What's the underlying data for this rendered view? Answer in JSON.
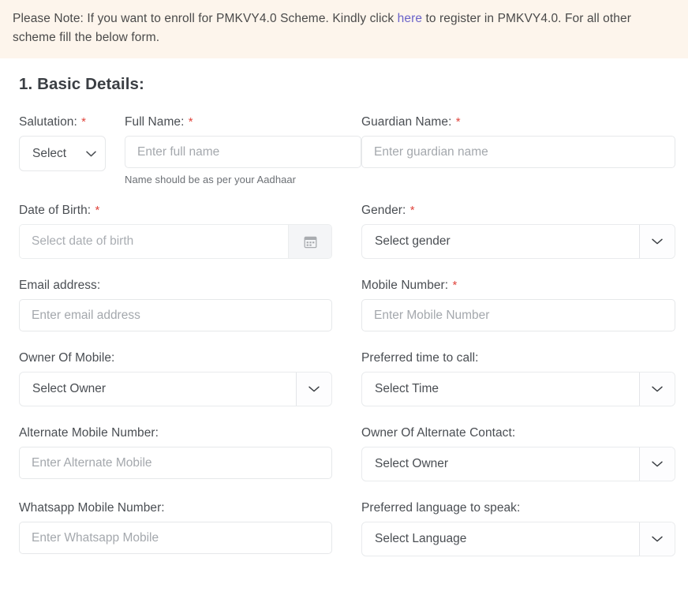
{
  "notice": {
    "text_before_link": "Please Note: If you want to enroll for PMKVY4.0 Scheme. Kindly click ",
    "link_label": "here",
    "text_after_link": " to register in PMKVY4.0. For all other scheme fill the below form.",
    "background_color": "#fdf5ec",
    "link_color": "#6a63c9"
  },
  "section": {
    "title": "1. Basic Details:",
    "required_marker": "*",
    "required_color": "#e0453d"
  },
  "fields": {
    "salutation": {
      "label": "Salutation:",
      "required": true,
      "selected": "Select",
      "icon": "chevron-down-icon"
    },
    "full_name": {
      "label": "Full Name:",
      "required": true,
      "value": "",
      "placeholder": "Enter full name",
      "helper": "Name should be as per your Aadhaar"
    },
    "guardian_name": {
      "label": "Guardian Name:",
      "required": true,
      "value": "",
      "placeholder": "Enter guardian name"
    },
    "date_of_birth": {
      "label": "Date of Birth:",
      "required": true,
      "value": "",
      "placeholder": "Select date of birth",
      "icon": "calendar-icon"
    },
    "gender": {
      "label": "Gender:",
      "required": true,
      "selected": "Select gender",
      "icon": "chevron-down-icon"
    },
    "email_address": {
      "label": "Email address:",
      "required": false,
      "value": "",
      "placeholder": "Enter email address"
    },
    "mobile_number": {
      "label": "Mobile Number:",
      "required": true,
      "value": "",
      "placeholder": "Enter Mobile Number"
    },
    "owner_of_mobile": {
      "label": "Owner Of Mobile:",
      "required": false,
      "selected": "Select Owner",
      "icon": "chevron-down-icon"
    },
    "preferred_time_to_call": {
      "label": "Preferred time to call:",
      "required": false,
      "selected": "Select Time",
      "icon": "chevron-down-icon"
    },
    "alternate_mobile_number": {
      "label": "Alternate Mobile Number:",
      "required": false,
      "value": "",
      "placeholder": "Enter Alternate Mobile"
    },
    "owner_of_alternate_contact": {
      "label": "Owner Of Alternate Contact:",
      "required": false,
      "selected": "Select Owner",
      "icon": "chevron-down-icon"
    },
    "whatsapp_mobile_number": {
      "label": "Whatsapp Mobile Number:",
      "required": false,
      "value": "",
      "placeholder": "Enter Whatsapp Mobile"
    },
    "preferred_language_to_speak": {
      "label": "Preferred language to speak:",
      "required": false,
      "selected": "Select Language",
      "icon": "chevron-down-icon"
    }
  }
}
